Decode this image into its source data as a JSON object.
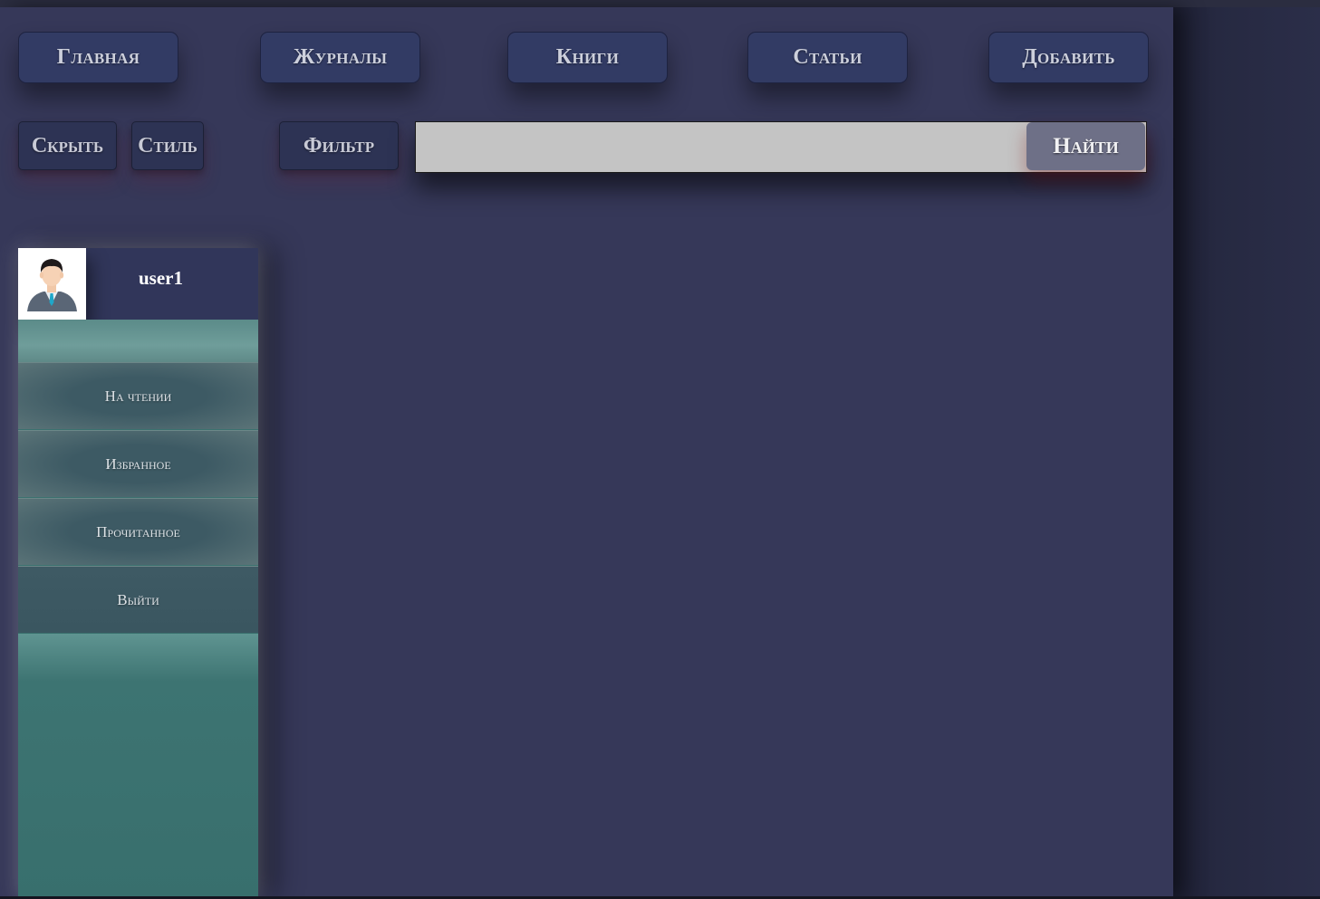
{
  "nav": {
    "home": "Главная",
    "journals": "Журналы",
    "books": "Книги",
    "articles": "Статьи",
    "add": "Добавить"
  },
  "toolbar": {
    "hide": "Скрыть",
    "style": "Стиль",
    "filter": "Фильтр"
  },
  "search": {
    "value": "",
    "button": "Найти"
  },
  "profile": {
    "username": "user1",
    "avatar_icon": "user-avatar-icon"
  },
  "menu": {
    "items": [
      {
        "label": "На чтении"
      },
      {
        "label": "Избранное"
      },
      {
        "label": "Прочитанное"
      },
      {
        "label": "Выйти"
      }
    ]
  },
  "colors": {
    "page_background": "#363859",
    "nav_button": "#323b64",
    "sidebar_accent": "#3b716f",
    "search_field": "#c4c4c4",
    "search_button": "#6e7087"
  }
}
